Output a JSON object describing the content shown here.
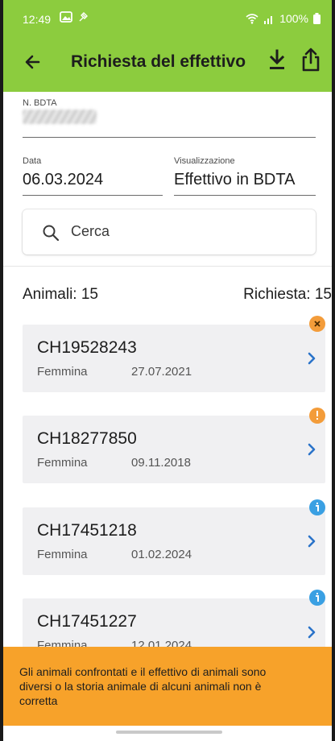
{
  "status_bar": {
    "time": "12:49",
    "battery": "100%"
  },
  "app_bar": {
    "title": "Richiesta del effettivo"
  },
  "form": {
    "bdta_label": "N. BDTA",
    "date_label": "Data",
    "date_value": "06.03.2024",
    "view_label": "Visualizzazione",
    "view_value": "Effettivo in BDTA",
    "search_placeholder": "Cerca"
  },
  "summary": {
    "animals": "Animali: 15",
    "requested": "Richiesta: 15"
  },
  "animals": [
    {
      "id": "CH19528243",
      "sex": "Femmina",
      "date": "27.07.2021",
      "badge": "error"
    },
    {
      "id": "CH18277850",
      "sex": "Femmina",
      "date": "09.11.2018",
      "badge": "warning"
    },
    {
      "id": "CH17451218",
      "sex": "Femmina",
      "date": "01.02.2024",
      "badge": "info"
    },
    {
      "id": "CH17451227",
      "sex": "Femmina",
      "date": "12.01.2024",
      "badge": "info"
    }
  ],
  "badge_colors": {
    "error": "#f39c3a",
    "warning": "#f39c3a",
    "info": "#3aa0e3"
  },
  "banner": {
    "text": "Gli animali confrontati e il effettivo di animali sono diversi o la storia animale di alcuni animali non è corretta"
  },
  "colors": {
    "header": "#8ccc3e",
    "banner": "#f7a22a",
    "chevron": "#2a73c9"
  }
}
